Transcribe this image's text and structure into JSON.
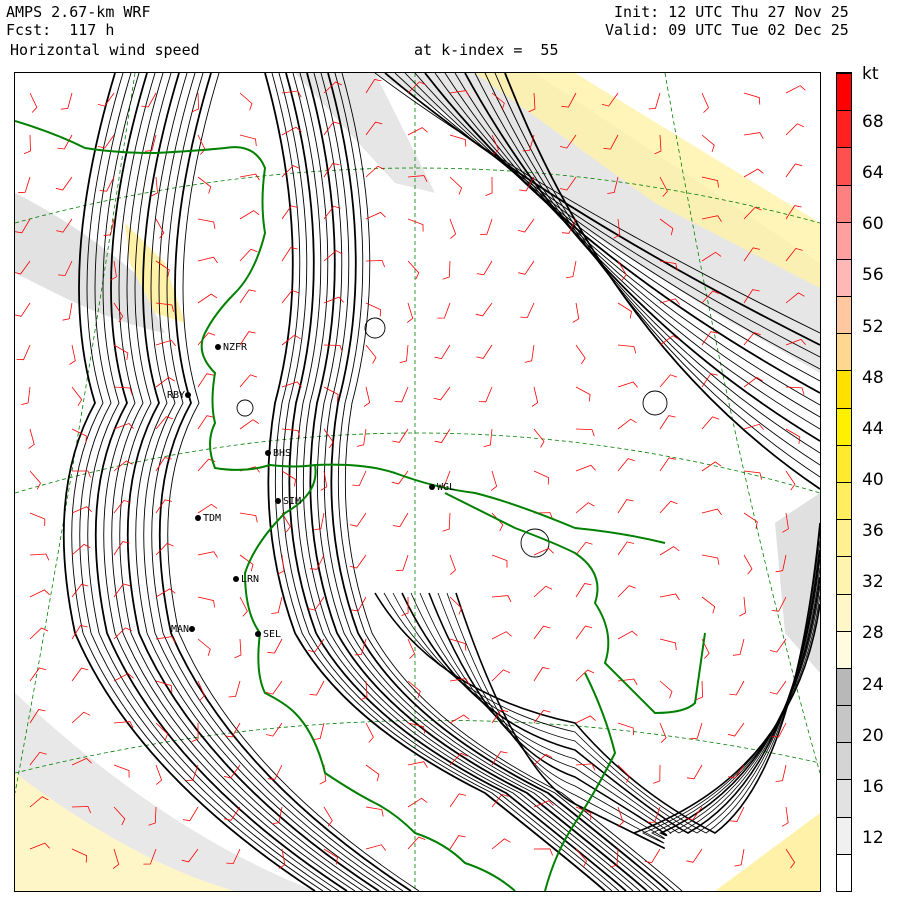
{
  "header": {
    "model": "AMPS 2.67-km WRF",
    "forecast": "Fcst:  117 h",
    "field": "Horizontal wind speed",
    "level": "at k-index =  55",
    "init": "Init: 12 UTC Thu 27 Nov 25",
    "valid": "Valid: 09 UTC Tue 02 Dec 25"
  },
  "colorbar": {
    "unit": "kt",
    "labels": [
      "68",
      "64",
      "60",
      "56",
      "52",
      "48",
      "44",
      "40",
      "36",
      "32",
      "28",
      "24",
      "20",
      "16",
      "12"
    ],
    "colors": [
      "#ffffff",
      "#f0f0f0",
      "#e2e2e2",
      "#d4d4d4",
      "#c6c6c6",
      "#b8b8b8",
      "#fffbe0",
      "#fff7c8",
      "#fff3b0",
      "#fff090",
      "#ffee60",
      "#ffea30",
      "#fff000",
      "#ffe000",
      "#ffd890",
      "#ffc8a0",
      "#ffb8b8",
      "#ffa0a0",
      "#ff8080",
      "#ff5050",
      "#ff2020",
      "#ff0000"
    ]
  },
  "stations": [
    {
      "id": "NZFR",
      "label": "NZFR"
    },
    {
      "id": "RBY",
      "label": "RBY"
    },
    {
      "id": "BHS",
      "label": "BHS"
    },
    {
      "id": "WGL",
      "label": "WGL"
    },
    {
      "id": "TDM",
      "label": "TDM"
    },
    {
      "id": "SIM",
      "label": "SIM"
    },
    {
      "id": "LRN",
      "label": "LRN"
    },
    {
      "id": "MAN",
      "label": "MAN"
    },
    {
      "id": "SEL",
      "label": "SEL"
    }
  ],
  "colors": {
    "contour": "#000000",
    "barb": "#ff0000",
    "coast": "#008000",
    "grid": "#008000",
    "shade_low": "#d8d8d8",
    "shade_yellow": "#fff2a8"
  }
}
